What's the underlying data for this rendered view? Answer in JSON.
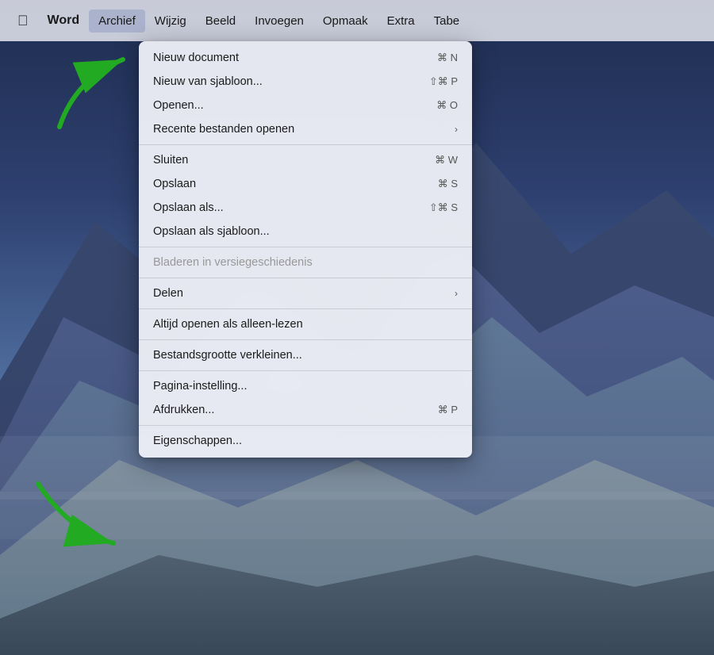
{
  "menubar": {
    "apple": "⌘",
    "items": [
      {
        "id": "word",
        "label": "Word",
        "active": false,
        "bold": true
      },
      {
        "id": "archief",
        "label": "Archief",
        "active": true
      },
      {
        "id": "wijzig",
        "label": "Wijzig",
        "active": false
      },
      {
        "id": "beeld",
        "label": "Beeld",
        "active": false
      },
      {
        "id": "invoegen",
        "label": "Invoegen",
        "active": false
      },
      {
        "id": "opmaak",
        "label": "Opmaak",
        "active": false
      },
      {
        "id": "extra",
        "label": "Extra",
        "active": false
      },
      {
        "id": "tabe",
        "label": "Tabe",
        "active": false
      }
    ]
  },
  "menu": {
    "items": [
      {
        "id": "nieuw-document",
        "label": "Nieuw document",
        "shortcut": "⌘ N",
        "type": "item",
        "disabled": false
      },
      {
        "id": "nieuw-van-sjabloon",
        "label": "Nieuw van sjabloon...",
        "shortcut": "⇧⌘ P",
        "type": "item",
        "disabled": false
      },
      {
        "id": "openen",
        "label": "Openen...",
        "shortcut": "⌘ O",
        "type": "item",
        "disabled": false
      },
      {
        "id": "recente-bestanden",
        "label": "Recente bestanden openen",
        "shortcut": "",
        "type": "submenu",
        "disabled": false
      },
      {
        "id": "sep1",
        "type": "separator"
      },
      {
        "id": "sluiten",
        "label": "Sluiten",
        "shortcut": "⌘ W",
        "type": "item",
        "disabled": false
      },
      {
        "id": "opslaan",
        "label": "Opslaan",
        "shortcut": "⌘ S",
        "type": "item",
        "disabled": false
      },
      {
        "id": "opslaan-als",
        "label": "Opslaan als...",
        "shortcut": "⇧⌘ S",
        "type": "item",
        "disabled": false
      },
      {
        "id": "opslaan-als-sjabloon",
        "label": "Opslaan als sjabloon...",
        "shortcut": "",
        "type": "item",
        "disabled": false
      },
      {
        "id": "sep2",
        "type": "separator"
      },
      {
        "id": "bladeren",
        "label": "Bladeren in versiegeschiedenis",
        "shortcut": "",
        "type": "item",
        "disabled": true
      },
      {
        "id": "sep3",
        "type": "separator"
      },
      {
        "id": "delen",
        "label": "Delen",
        "shortcut": "",
        "type": "submenu",
        "disabled": false
      },
      {
        "id": "sep4",
        "type": "separator"
      },
      {
        "id": "altijd-openen",
        "label": "Altijd openen als alleen-lezen",
        "shortcut": "",
        "type": "item",
        "disabled": false
      },
      {
        "id": "sep5",
        "type": "separator"
      },
      {
        "id": "bestandsgrootte",
        "label": "Bestandsgrootte verkleinen...",
        "shortcut": "",
        "type": "item",
        "disabled": false
      },
      {
        "id": "sep6",
        "type": "separator"
      },
      {
        "id": "pagina-instelling",
        "label": "Pagina-instelling...",
        "shortcut": "",
        "type": "item",
        "disabled": false
      },
      {
        "id": "afdrukken",
        "label": "Afdrukken...",
        "shortcut": "⌘ P",
        "type": "item",
        "disabled": false
      },
      {
        "id": "sep7",
        "type": "separator"
      },
      {
        "id": "eigenschappen",
        "label": "Eigenschappen...",
        "shortcut": "",
        "type": "item",
        "disabled": false
      }
    ]
  }
}
